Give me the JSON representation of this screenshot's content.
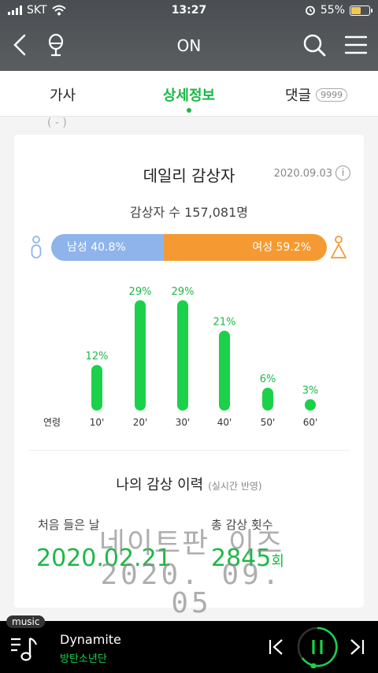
{
  "status": {
    "carrier": "SKT",
    "time": "13:27",
    "battery": "55%"
  },
  "nav": {
    "title": "ON"
  },
  "tabs": {
    "lyrics": "가사",
    "detail": "상세정보",
    "comments": "댓글",
    "comments_badge": "9999"
  },
  "peek": "(  -  )",
  "daily": {
    "title": "데일리 감상자",
    "date": "2020.09.03",
    "info_icon": "i",
    "listeners": "감상자 수 157,081명",
    "male": "남성 40.8%",
    "female": "여성 59.2%",
    "male_ratio": 40.8
  },
  "chart_data": {
    "type": "bar",
    "xlabel": "연령",
    "categories": [
      "10'",
      "20'",
      "30'",
      "40'",
      "50'",
      "60'"
    ],
    "values": [
      12,
      29,
      29,
      21,
      6,
      3
    ],
    "labels": [
      "12%",
      "29%",
      "29%",
      "21%",
      "6%",
      "3%"
    ],
    "color": "#1bd14a"
  },
  "history": {
    "title": "나의 감상 이력",
    "subtitle": "(실시간 반영)",
    "first_label": "처음 들은 날",
    "first_date": "2020.02.21",
    "total_label": "총 감상 횟수",
    "total_count": "2845",
    "total_unit": "회"
  },
  "watermark": {
    "line1": "네이트판 이즈",
    "line2": "2020. 09. 05"
  },
  "player": {
    "tag": "music",
    "title": "Dynamite",
    "artist": "방탄소년단"
  }
}
